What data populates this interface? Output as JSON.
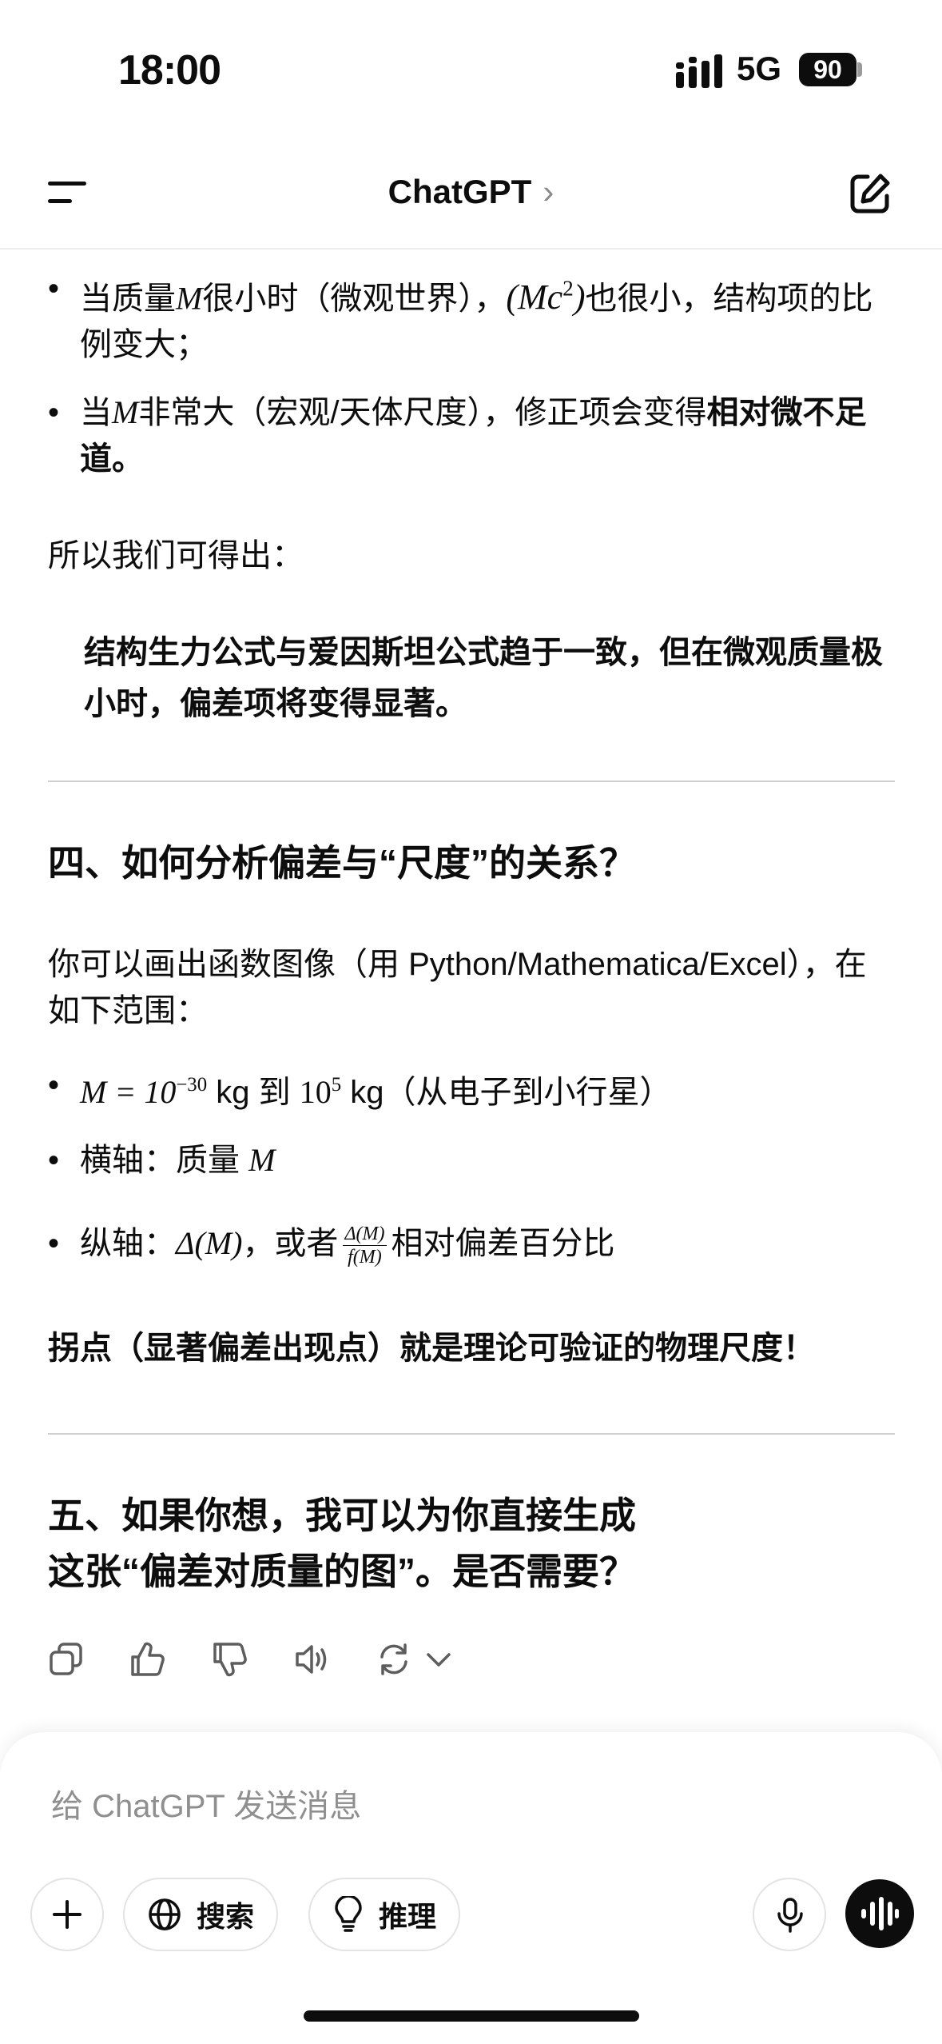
{
  "status_bar": {
    "time": "18:00",
    "network": "5G",
    "battery": "90"
  },
  "header": {
    "title": "ChatGPT",
    "chevron": "›"
  },
  "content": {
    "b1_pre": "当质量",
    "b1_var": "M",
    "b1_mid": "很小时（微观世界），",
    "b1_expr_l": "(Mc",
    "b1_exp": "2",
    "b1_expr_r": ")",
    "b1_post": "也很小，结构项的比例变大；",
    "b2_pre": "当",
    "b2_var": "M",
    "b2_mid": "非常大（宏观/天体尺度），修正项会变得",
    "b2_bold": "相对微不足道。",
    "conclusion_intro": "所以我们可得出：",
    "conclusion_quote": "结构生力公式与爱因斯坦公式趋于一致，但在微观质量极小时，偏差项将变得显著。",
    "section4_heading": "四、如何分析偏差与“尺度”的关系？",
    "section4_intro": "你可以画出函数图像（用 Python/Mathematica/Excel），在如下范围：",
    "range_lhs": "M = 10",
    "range_exp1": "−30",
    "range_mid": " kg 到 ",
    "range_base2": "10",
    "range_exp2": "5",
    "range_post": " kg（从电子到小行星）",
    "xaxis_pre": "横轴：质量",
    "xaxis_var": "M",
    "yaxis_pre": "纵轴：",
    "yaxis_expr": "Δ(M)",
    "yaxis_mid": "，或者",
    "frac_num": "Δ(M)",
    "frac_den": "f(M)",
    "yaxis_post": "相对偏差百分比",
    "inflection_note": "拐点（显著偏差出现点）就是理论可验证的物理尺度！",
    "section5_line1": "五、如果你想，我可以为你直接生成",
    "section5_line2": "这张“偏差对质量的图”。是否需要？"
  },
  "icons": {
    "actions": [
      "copy-icon",
      "thumbs-up-icon",
      "thumbs-down-icon",
      "read-aloud-icon",
      "regenerate-icon",
      "chevron-down-icon"
    ]
  },
  "composer": {
    "placeholder": "给 ChatGPT 发送消息",
    "search_label": "搜索",
    "reason_label": "推理"
  }
}
